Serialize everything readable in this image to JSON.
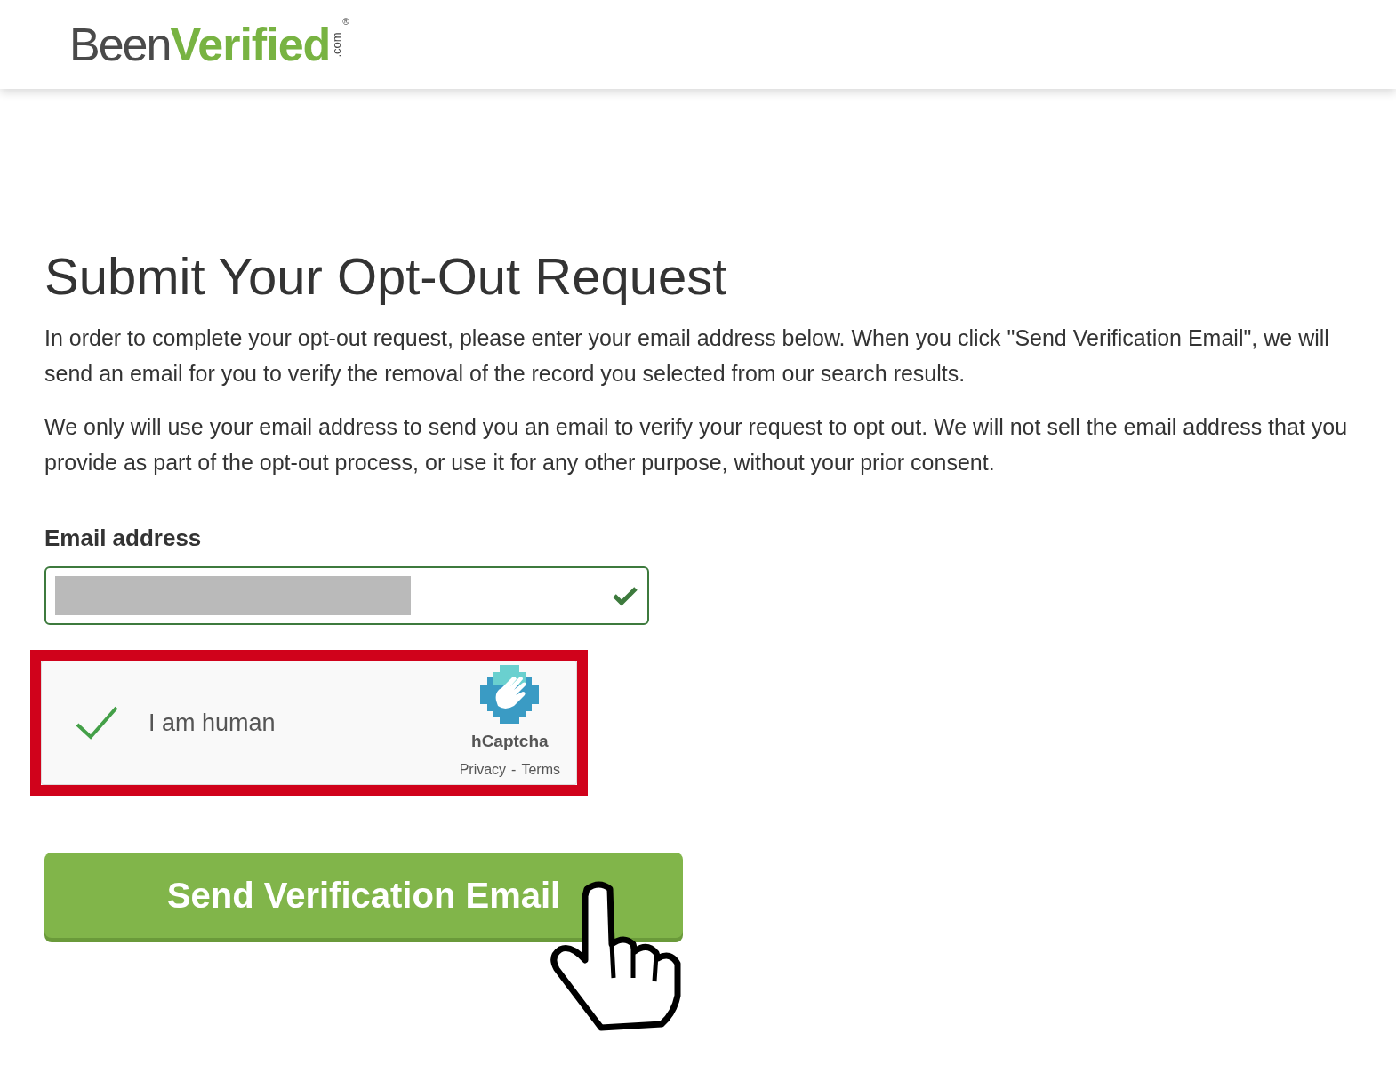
{
  "header": {
    "logo": {
      "part_1": "Been",
      "part_2": "Verified",
      "suffix": ".com",
      "registered": "®"
    }
  },
  "title": "Submit Your Opt-Out Request",
  "paragraphs": [
    "In order to complete your opt-out request, please enter your email address below. When you click \"Send Verification Email\", we will send an email for you to verify the removal of the record you selected from our search results.",
    "We only will use your email address to send you an email to verify your request to opt out. We will not sell the email address that you provide as part of the opt-out process, or use it for any other purpose, without your prior consent."
  ],
  "email_field": {
    "label": "Email address",
    "redacted": true,
    "valid": true
  },
  "captcha": {
    "checked": true,
    "label": "I am human",
    "brand": "hCaptcha",
    "links": [
      "Privacy",
      "Terms"
    ],
    "separator": "-",
    "highlighted": true
  },
  "submit_button": {
    "label": "Send Verification Email"
  }
}
